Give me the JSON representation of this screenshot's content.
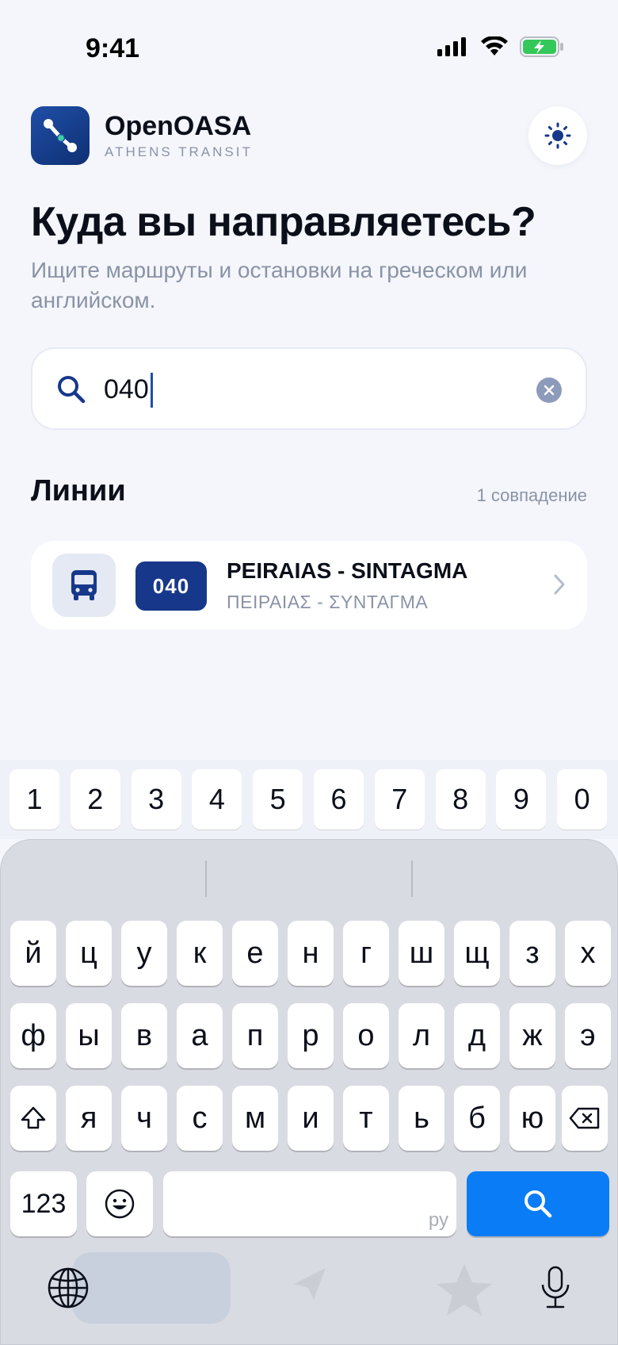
{
  "status": {
    "time": "9:41"
  },
  "app": {
    "name": "OpenOASA",
    "subtitle": "ATHENS TRANSIT"
  },
  "page": {
    "title": "Куда вы направляетесь?",
    "subtitle": "Ищите маршруты и остановки на греческом или английском."
  },
  "search": {
    "value": "040",
    "placeholder": ""
  },
  "lines": {
    "title": "Линии",
    "count": "1 совпадение",
    "items": [
      {
        "code": "040",
        "name": "PEIRAIAS - SINTAGMA",
        "greek": "ΠΕΙΡΑΙΑΣ - ΣΥΝΤΑΓΜΑ"
      }
    ]
  },
  "keyboard": {
    "numbers": [
      "1",
      "2",
      "3",
      "4",
      "5",
      "6",
      "7",
      "8",
      "9",
      "0"
    ],
    "row1": [
      "й",
      "ц",
      "у",
      "к",
      "е",
      "н",
      "г",
      "ш",
      "щ",
      "з",
      "х"
    ],
    "row2": [
      "ф",
      "ы",
      "в",
      "а",
      "п",
      "р",
      "о",
      "л",
      "д",
      "ж",
      "э"
    ],
    "row3": [
      "я",
      "ч",
      "с",
      "м",
      "и",
      "т",
      "ь",
      "б",
      "ю"
    ],
    "mode_key": "123",
    "space_hint": "ру"
  },
  "colors": {
    "accent": "#17388a",
    "search_key": "#0a7cf5",
    "battery": "#34c759"
  }
}
